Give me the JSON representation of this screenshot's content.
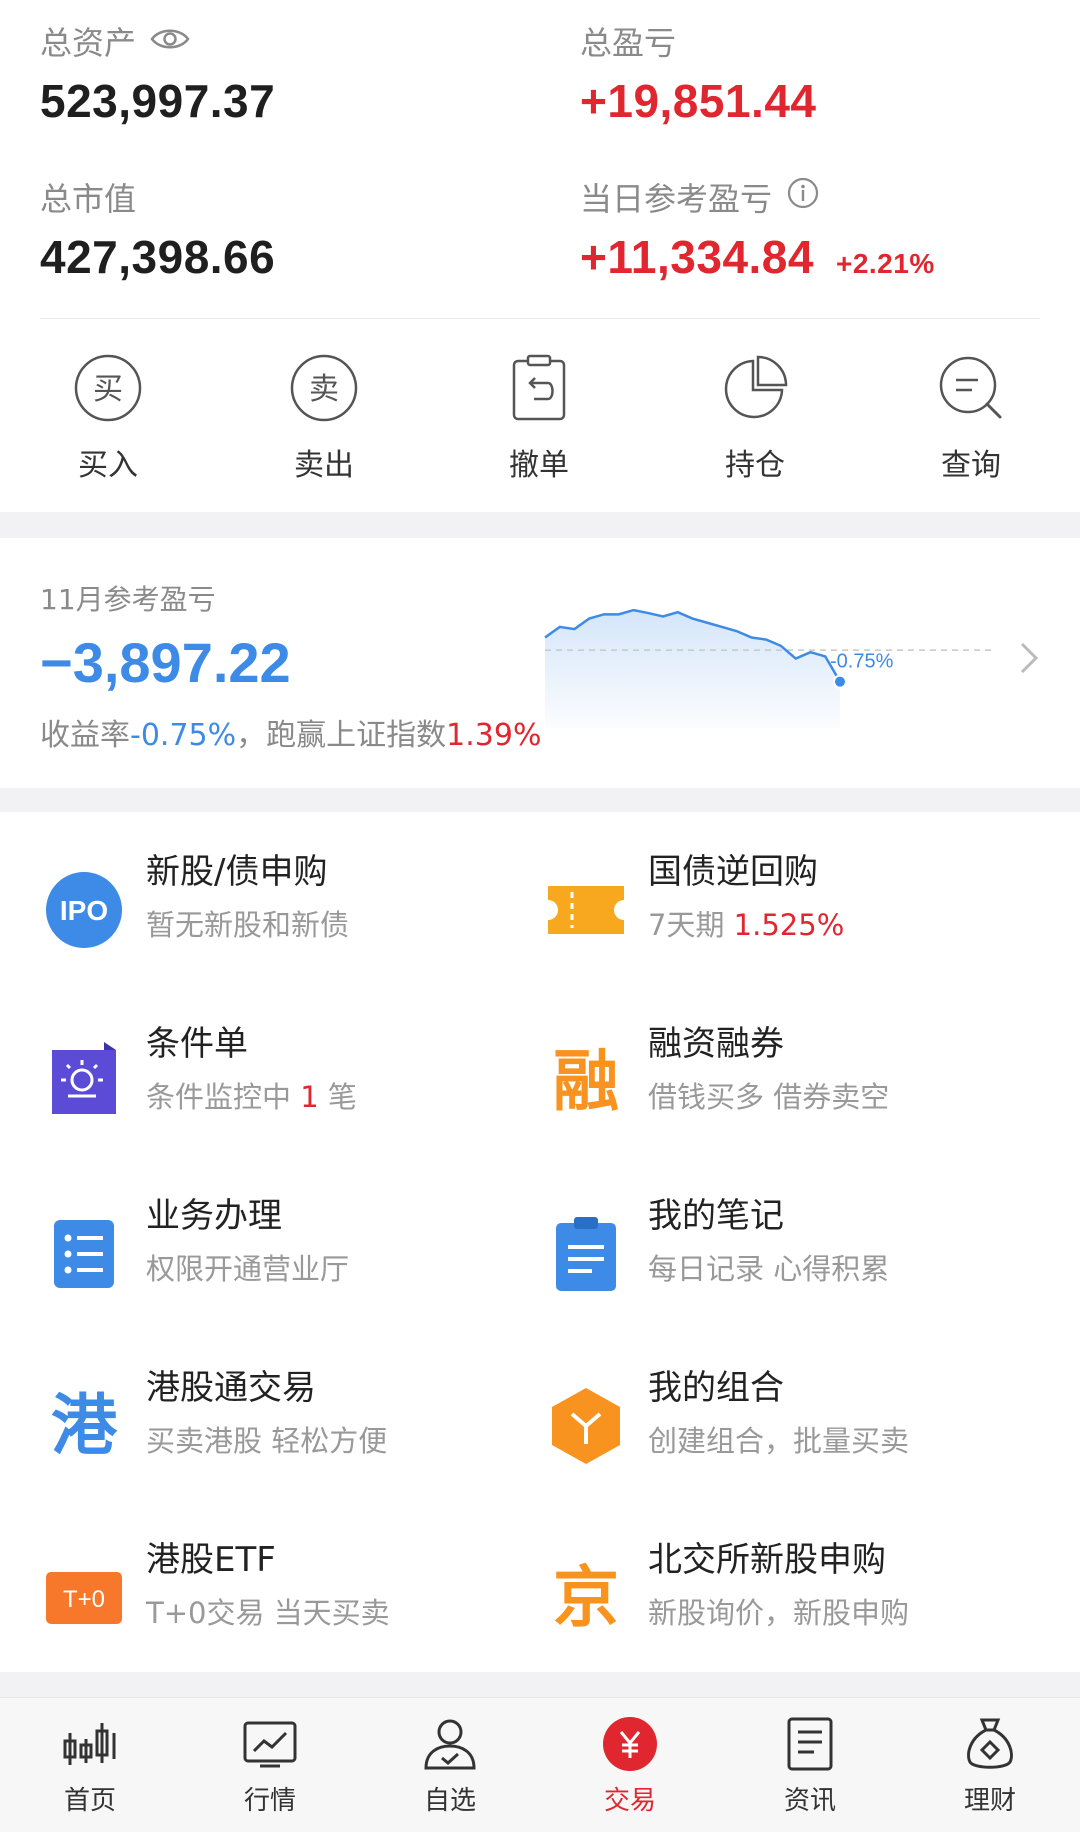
{
  "summary": {
    "total_assets_label": "总资产",
    "total_assets_value": "523,997.37",
    "total_pnl_label": "总盈亏",
    "total_pnl_value": "+19,851.44",
    "market_value_label": "总市值",
    "market_value_value": "427,398.66",
    "daily_pnl_label": "当日参考盈亏",
    "daily_pnl_value": "+11,334.84",
    "daily_pnl_pct": "+2.21%"
  },
  "actions": [
    {
      "label": "买入",
      "glyph": "买",
      "icon": "buy-icon"
    },
    {
      "label": "卖出",
      "glyph": "卖",
      "icon": "sell-icon"
    },
    {
      "label": "撤单",
      "icon": "cancel-order-icon"
    },
    {
      "label": "持仓",
      "icon": "pie-chart-icon"
    },
    {
      "label": "查询",
      "icon": "search-icon"
    }
  ],
  "monthly": {
    "label": "11月参考盈亏",
    "value": "−3,897.22",
    "yield_prefix": "收益率",
    "yield_value": "-0.75%",
    "compare_text": "，跑赢上证指数",
    "compare_value": "1.39%",
    "chart_end_label": "-0.75%",
    "chart_points": [
      0.3,
      0.55,
      0.5,
      0.75,
      0.85,
      0.85,
      0.95,
      0.88,
      0.8,
      0.9,
      0.75,
      0.65,
      0.55,
      0.45,
      0.3,
      0.25,
      0.1,
      -0.2,
      -0.05,
      -0.15,
      -0.75
    ]
  },
  "features": [
    {
      "title": "新股/债申购",
      "sub": "暂无新股和新债",
      "icon": "ipo-icon",
      "icon_text": "IPO"
    },
    {
      "title": "国债逆回购",
      "sub": "7天期 ",
      "sub_highlight": "1.525%",
      "icon": "ticket-icon"
    },
    {
      "title": "条件单",
      "sub": "条件监控中 ",
      "sub_highlight": "1",
      "sub_tail": " 笔",
      "icon": "condition-order-icon"
    },
    {
      "title": "融资融券",
      "sub": "借钱买多 借券卖空",
      "icon": "margin-icon",
      "icon_text": "融"
    },
    {
      "title": "业务办理",
      "sub": "权限开通营业厅",
      "icon": "business-list-icon"
    },
    {
      "title": "我的笔记",
      "sub": "每日记录 心得积累",
      "icon": "notes-icon"
    },
    {
      "title": "港股通交易",
      "sub": "买卖港股 轻松方便",
      "icon": "hk-connect-icon",
      "icon_text": "港"
    },
    {
      "title": "我的组合",
      "sub": "创建组合，批量买卖",
      "icon": "portfolio-cube-icon"
    },
    {
      "title": "港股ETF",
      "sub": "T+0交易 当天买卖",
      "icon": "t0-icon",
      "icon_text": "T+0"
    },
    {
      "title": "北交所新股申购",
      "sub": "新股询价，新股申购",
      "icon": "bse-icon",
      "icon_text": "京"
    }
  ],
  "tabs": [
    {
      "label": "首页",
      "icon": "candlestick-icon"
    },
    {
      "label": "行情",
      "icon": "market-monitor-icon"
    },
    {
      "label": "自选",
      "icon": "user-star-icon"
    },
    {
      "label": "交易",
      "icon": "yuan-coin-icon",
      "active": true
    },
    {
      "label": "资讯",
      "icon": "news-doc-icon"
    },
    {
      "label": "理财",
      "icon": "money-bag-icon"
    }
  ],
  "colors": {
    "red": "#e0262e",
    "blue": "#3d8be6",
    "orange": "#f7931e",
    "purple": "#5b4bd6"
  }
}
